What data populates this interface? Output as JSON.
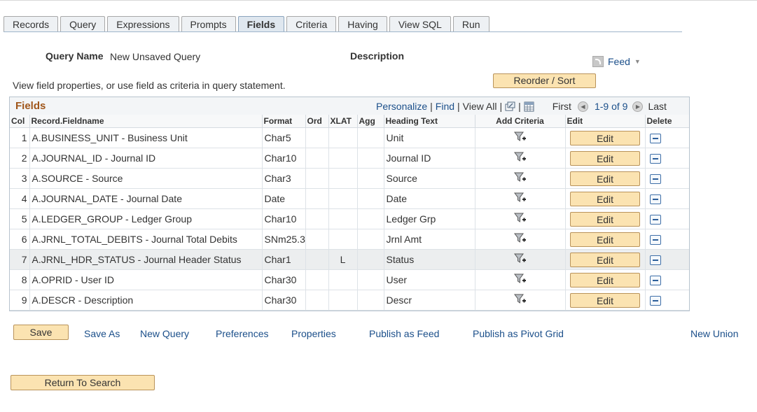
{
  "tabs": [
    "Records",
    "Query",
    "Expressions",
    "Prompts",
    "Fields",
    "Criteria",
    "Having",
    "View SQL",
    "Run"
  ],
  "active_tab": "Fields",
  "query_name_label": "Query Name",
  "query_name_value": "New Unsaved Query",
  "description_label": "Description",
  "feed_label": "Feed",
  "reorder_button": "Reorder / Sort",
  "instruction": "View field properties, or use field as criteria in query statement.",
  "grid": {
    "title": "Fields",
    "personalize": "Personalize",
    "find": "Find",
    "view_all": "View All",
    "first": "First",
    "range": "1-9 of 9",
    "last": "Last",
    "columns": [
      "Col",
      "Record.Fieldname",
      "Format",
      "Ord",
      "XLAT",
      "Agg",
      "Heading Text",
      "Add Criteria",
      "Edit",
      "Delete"
    ],
    "edit_label": "Edit",
    "rows": [
      {
        "col": "1",
        "field": "A.BUSINESS_UNIT - Business Unit",
        "format": "Char5",
        "ord": "",
        "xlat": "",
        "agg": "",
        "heading": "Unit"
      },
      {
        "col": "2",
        "field": "A.JOURNAL_ID - Journal ID",
        "format": "Char10",
        "ord": "",
        "xlat": "",
        "agg": "",
        "heading": "Journal ID"
      },
      {
        "col": "3",
        "field": "A.SOURCE - Source",
        "format": "Char3",
        "ord": "",
        "xlat": "",
        "agg": "",
        "heading": "Source"
      },
      {
        "col": "4",
        "field": "A.JOURNAL_DATE - Journal Date",
        "format": "Date",
        "ord": "",
        "xlat": "",
        "agg": "",
        "heading": "Date"
      },
      {
        "col": "5",
        "field": "A.LEDGER_GROUP - Ledger Group",
        "format": "Char10",
        "ord": "",
        "xlat": "",
        "agg": "",
        "heading": "Ledger Grp"
      },
      {
        "col": "6",
        "field": "A.JRNL_TOTAL_DEBITS - Journal Total Debits",
        "format": "SNm25.3",
        "ord": "",
        "xlat": "",
        "agg": "",
        "heading": "Jrnl Amt"
      },
      {
        "col": "7",
        "field": "A.JRNL_HDR_STATUS - Journal Header Status",
        "format": "Char1",
        "ord": "",
        "xlat": "L",
        "agg": "",
        "heading": "Status"
      },
      {
        "col": "8",
        "field": "A.OPRID - User ID",
        "format": "Char30",
        "ord": "",
        "xlat": "",
        "agg": "",
        "heading": "User"
      },
      {
        "col": "9",
        "field": "A.DESCR - Description",
        "format": "Char30",
        "ord": "",
        "xlat": "",
        "agg": "",
        "heading": "Descr"
      }
    ]
  },
  "footer": {
    "save": "Save",
    "save_as": "Save As",
    "new_query": "New Query",
    "preferences": "Preferences",
    "properties": "Properties",
    "publish_feed": "Publish as Feed",
    "publish_pivot": "Publish as Pivot Grid",
    "new_union": "New Union",
    "return_to_search": "Return To Search"
  },
  "colors": {
    "accent_title": "#a0561a",
    "link": "#1b4f8a",
    "button": "#fbe3b1"
  }
}
